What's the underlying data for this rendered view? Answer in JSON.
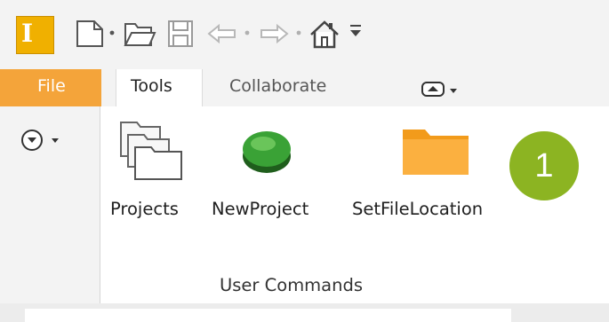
{
  "app": {
    "logo_letter": "I"
  },
  "quick_access": {
    "icons": [
      "new-file-icon",
      "open-folder-icon",
      "save-icon",
      "undo-icon",
      "redo-icon",
      "home-icon",
      "customize-qat-icon"
    ]
  },
  "tabs": [
    {
      "label": "File"
    },
    {
      "label": "Tools"
    },
    {
      "label": "Collaborate"
    }
  ],
  "ribbon": {
    "commands": [
      {
        "label": "Projects",
        "icon": "projects-icon"
      },
      {
        "label": "NewProject",
        "icon": "start-button-icon"
      },
      {
        "label": "SetFileLocation",
        "icon": "folder-icon"
      }
    ],
    "group_label": "User Commands"
  },
  "callout": {
    "number": "1"
  },
  "colors": {
    "file_tab": "#f4a43a",
    "app_logo": "#f0b000",
    "badge": "#8cb422",
    "folder": "#fbb040",
    "start_button": "#3aa236"
  }
}
